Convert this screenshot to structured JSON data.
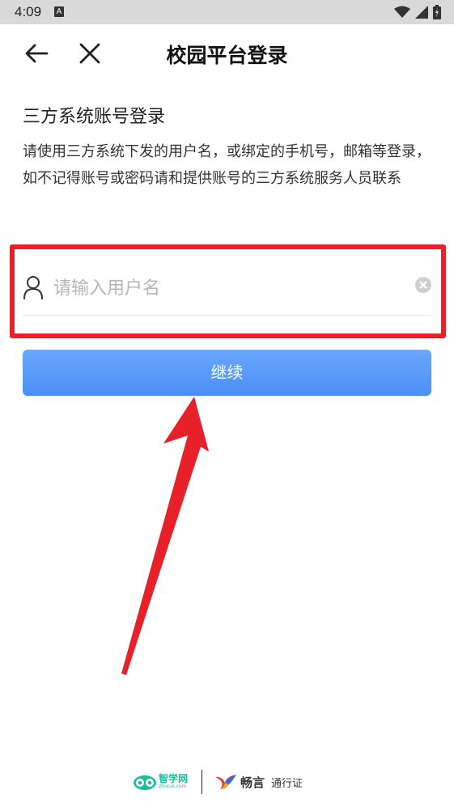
{
  "status_bar": {
    "time": "4:09",
    "notification_letter": "A"
  },
  "header": {
    "title": "校园平台登录"
  },
  "intro": {
    "title": "三方系统账号登录",
    "description": "请使用三方系统下发的用户名，或绑定的手机号，邮箱等登录，如不记得账号或密码请和提供账号的三方系统服务人员联系"
  },
  "form": {
    "username_placeholder": "请输入用户名",
    "username_value": "",
    "continue_label": "继续"
  },
  "footer": {
    "brand1_name": "智学网",
    "brand1_sub": "zhixue.com",
    "brand2_name": "畅言",
    "brand2_sub": "通行证"
  },
  "colors": {
    "accent": "#4b8ef5",
    "highlight": "#e8202a",
    "brand1": "#1dbf9a"
  }
}
